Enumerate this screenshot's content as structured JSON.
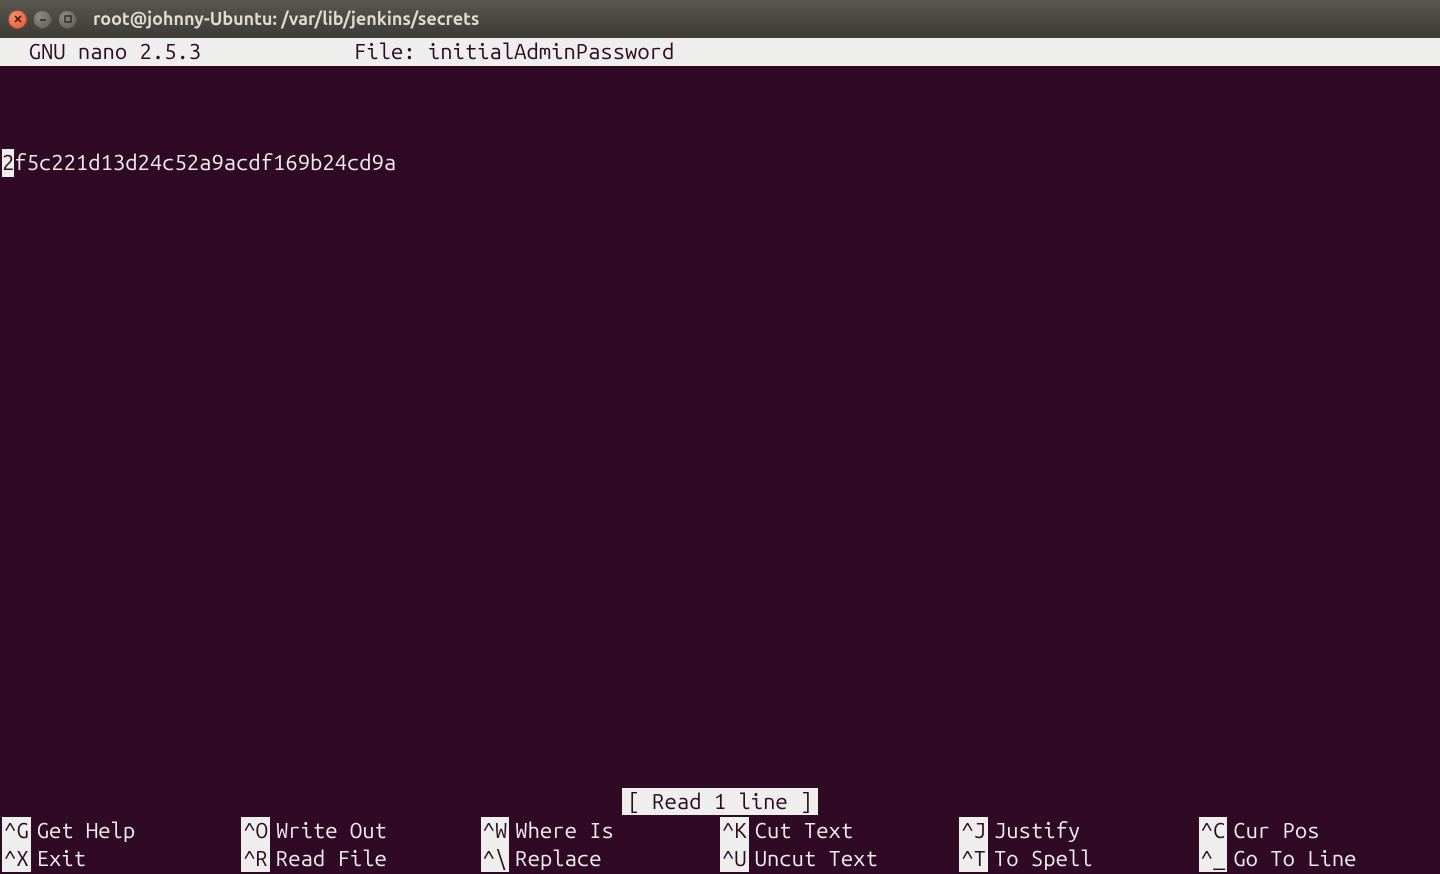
{
  "window": {
    "title": "root@johnny-Ubuntu: /var/lib/jenkins/secrets"
  },
  "nano": {
    "app_label": "  GNU nano 2.5.3",
    "file_label": "File: initialAdminPassword",
    "content_first_char": "2",
    "content_rest": "f5c221d13d24c52a9acdf169b24cd9a",
    "status": "[ Read 1 line ]"
  },
  "shortcuts": [
    {
      "key": "^G",
      "label": "Get Help"
    },
    {
      "key": "^O",
      "label": "Write Out"
    },
    {
      "key": "^W",
      "label": "Where Is"
    },
    {
      "key": "^K",
      "label": "Cut Text"
    },
    {
      "key": "^J",
      "label": "Justify"
    },
    {
      "key": "^C",
      "label": "Cur Pos"
    },
    {
      "key": "^X",
      "label": "Exit"
    },
    {
      "key": "^R",
      "label": "Read File"
    },
    {
      "key": "^\\",
      "label": "Replace"
    },
    {
      "key": "^U",
      "label": "Uncut Text"
    },
    {
      "key": "^T",
      "label": "To Spell"
    },
    {
      "key": "^_",
      "label": "Go To Line"
    }
  ]
}
